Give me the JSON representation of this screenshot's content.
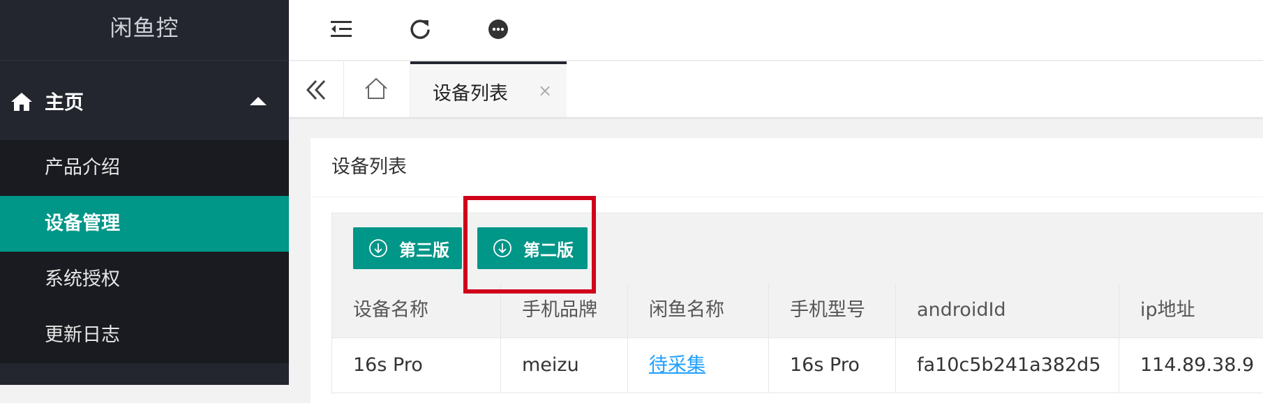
{
  "app": {
    "title": "闲鱼控"
  },
  "sidebar": {
    "section": {
      "label": "主页",
      "icon": "home-icon",
      "caret_icon": "caret-up-icon"
    },
    "items": [
      {
        "label": "产品介绍",
        "active": false
      },
      {
        "label": "设备管理",
        "active": true
      },
      {
        "label": "系统授权",
        "active": false
      },
      {
        "label": "更新日志",
        "active": false
      }
    ]
  },
  "header": {
    "icons": [
      "indent-icon",
      "refresh-icon",
      "chat-icon"
    ]
  },
  "tabs": {
    "back_icon": "double-chevron-left-icon",
    "home_icon": "home-outline-icon",
    "items": [
      {
        "label": "设备列表",
        "close": "×"
      }
    ]
  },
  "card": {
    "title": "设备列表",
    "buttons": [
      {
        "label": "第三版",
        "icon": "download-circle-icon"
      },
      {
        "label": "第二版",
        "icon": "download-circle-icon"
      }
    ]
  },
  "table": {
    "columns": [
      "设备名称",
      "手机品牌",
      "闲鱼名称",
      "手机型号",
      "androidId",
      "ip地址"
    ],
    "rows": [
      [
        "16s Pro",
        "meizu",
        "待采集",
        "16s Pro",
        "fa10c5b241a382d5",
        "114.89.38.9"
      ]
    ]
  },
  "colors": {
    "sidebar_bg": "#23262e",
    "accent": "#009688",
    "highlight": "#d0021b",
    "link": "#1e9fff"
  }
}
